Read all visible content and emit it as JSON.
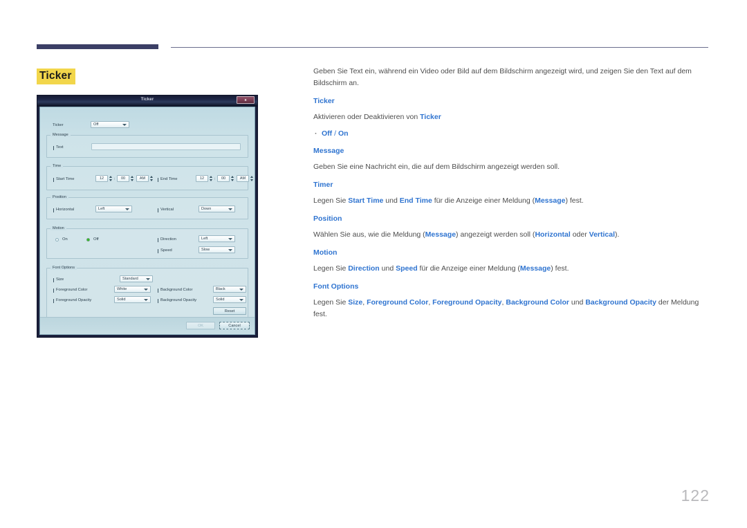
{
  "page": {
    "number": "122",
    "title": "Ticker",
    "title_highlight_color": "#f2d64b",
    "accent_color": "#2f74d0",
    "rule_color": "#3b3f66"
  },
  "content": {
    "intro": "Geben Sie Text ein, während ein Video oder Bild auf dem Bildschirm angezeigt wird, und zeigen Sie den Text auf dem Bildschirm an.",
    "sections": [
      {
        "heading": "Ticker",
        "body_pre": "Aktivieren oder Deaktivieren von ",
        "body_bold": "Ticker",
        "bullet": {
          "first": "Off",
          "sep": " / ",
          "second": "On"
        }
      },
      {
        "heading": "Message",
        "body": "Geben Sie eine Nachricht ein, die auf dem Bildschirm angezeigt werden soll."
      },
      {
        "heading": "Timer",
        "p1": "Legen Sie ",
        "b1": "Start Time",
        "p2": " und ",
        "b2": "End Time",
        "p3": " für die Anzeige einer Meldung (",
        "b3": "Message",
        "p4": ") fest."
      },
      {
        "heading": "Position",
        "p1": "Wählen Sie aus, wie die Meldung (",
        "b1": "Message",
        "p2": ") angezeigt werden soll (",
        "b2": "Horizontal",
        "p3": " oder ",
        "b3": "Vertical",
        "p4": ")."
      },
      {
        "heading": "Motion",
        "p1": "Legen Sie ",
        "b1": "Direction",
        "p2": " und ",
        "b2": "Speed",
        "p3": " für die Anzeige einer Meldung (",
        "b3": "Message",
        "p4": ") fest."
      },
      {
        "heading": "Font Options",
        "p1": "Legen Sie ",
        "b1": "Size",
        "p2": ", ",
        "b2": "Foreground Color",
        "p3": ", ",
        "b3": "Foreground Opacity",
        "p4": ", ",
        "b4": "Background Color",
        "p5": " und ",
        "b5": "Background Opacity",
        "p6": " der Meldung fest."
      }
    ]
  },
  "dialog": {
    "title": "Ticker",
    "close_label": "x",
    "ticker": {
      "label": "Ticker",
      "value": "Off"
    },
    "message": {
      "legend": "Message",
      "text_label": "Text",
      "text_value": ""
    },
    "time": {
      "legend": "Time",
      "start_label": "Start Time",
      "start_hour": "12",
      "start_minute": "00",
      "start_ampm": "AM",
      "end_label": "End Time",
      "end_hour": "12",
      "end_minute": "00",
      "end_ampm": "AM",
      "colon": ":"
    },
    "position": {
      "legend": "Position",
      "horizontal_label": "Horizontal",
      "horizontal_value": "Left",
      "vertical_label": "Vertical",
      "vertical_value": "Down"
    },
    "motion": {
      "legend": "Motion",
      "on_label": "On",
      "off_label": "Off",
      "selected": "Off",
      "direction_label": "Direction",
      "direction_value": "Left",
      "speed_label": "Speed",
      "speed_value": "Slow"
    },
    "font_options": {
      "legend": "Font Options",
      "size_label": "Size",
      "size_value": "Standard",
      "fg_color_label": "Foreground Color",
      "fg_color_value": "White",
      "bg_color_label": "Background Color",
      "bg_color_value": "Black",
      "fg_opacity_label": "Foreground Opacity",
      "fg_opacity_value": "Solid",
      "bg_opacity_label": "Background Opacity",
      "bg_opacity_value": "Solid",
      "reset_label": "Reset"
    },
    "footer": {
      "ok_label": "OK",
      "cancel_label": "Cancel"
    }
  }
}
